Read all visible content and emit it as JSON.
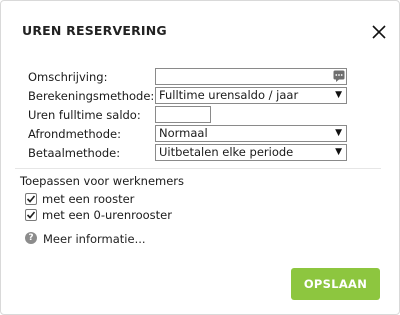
{
  "dialog": {
    "title": "UREN RESERVERING",
    "close_icon": "close-icon"
  },
  "form": {
    "omschrijving": {
      "label": "Omschrijving:",
      "value": "",
      "icon": "note-icon"
    },
    "berekeningsmethode": {
      "label": "Berekeningsmethode:",
      "selected": "Fulltime urensaldo / jaar"
    },
    "uren_fulltime_saldo": {
      "label": "Uren fulltime saldo:",
      "value": ""
    },
    "afrondmethode": {
      "label": "Afrondmethode:",
      "selected": "Normaal"
    },
    "betaalmethode": {
      "label": "Betaalmethode:",
      "selected": "Uitbetalen elke periode"
    }
  },
  "apply": {
    "label": "Toepassen voor werknemers",
    "options": [
      {
        "label": "met een rooster",
        "checked": true
      },
      {
        "label": "met een 0-urenrooster",
        "checked": true
      }
    ]
  },
  "help": {
    "label": "Meer informatie...",
    "icon": "question-circle-icon"
  },
  "actions": {
    "save_label": "OPSLAAN"
  },
  "colors": {
    "save_button": "#8dc63f",
    "border": "#8a8a8a"
  }
}
